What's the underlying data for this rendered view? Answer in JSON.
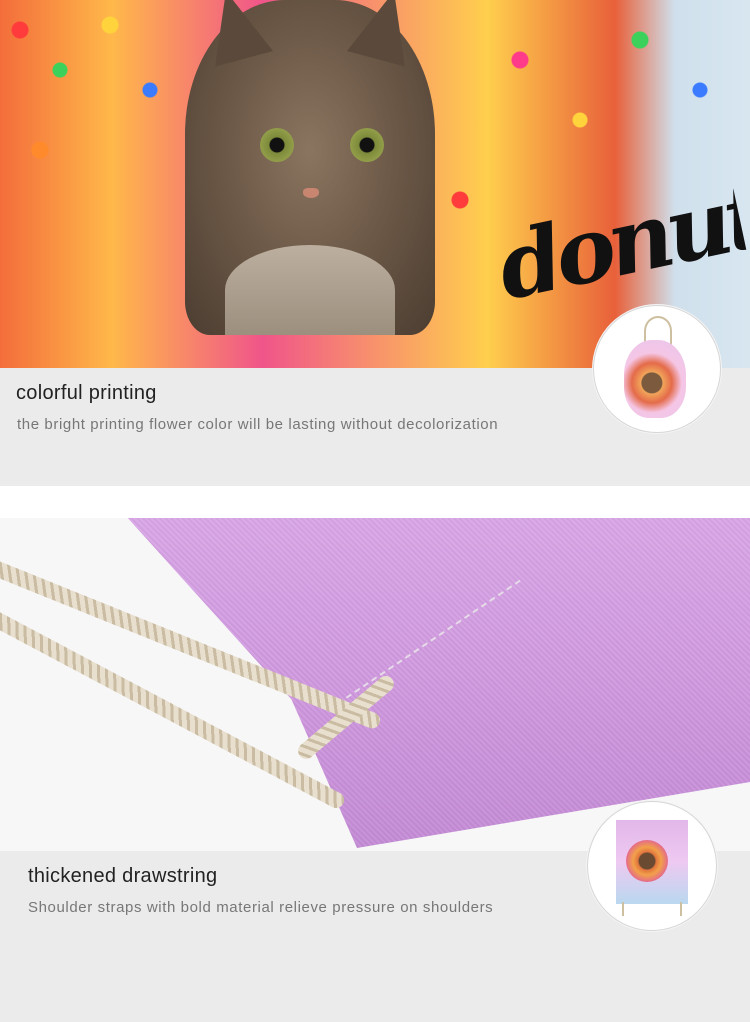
{
  "sections": [
    {
      "title": "colorful printing",
      "subtitle": "the bright printing flower color will be lasting without decolorization",
      "photo_lettering": "donut"
    },
    {
      "title": "thickened drawstring",
      "subtitle": "Shoulder straps with bold material relieve pressure on shoulders"
    }
  ],
  "colors": {
    "caption_bar": "#ebebeb",
    "title_text": "#222222",
    "subtitle_text": "#777777"
  }
}
